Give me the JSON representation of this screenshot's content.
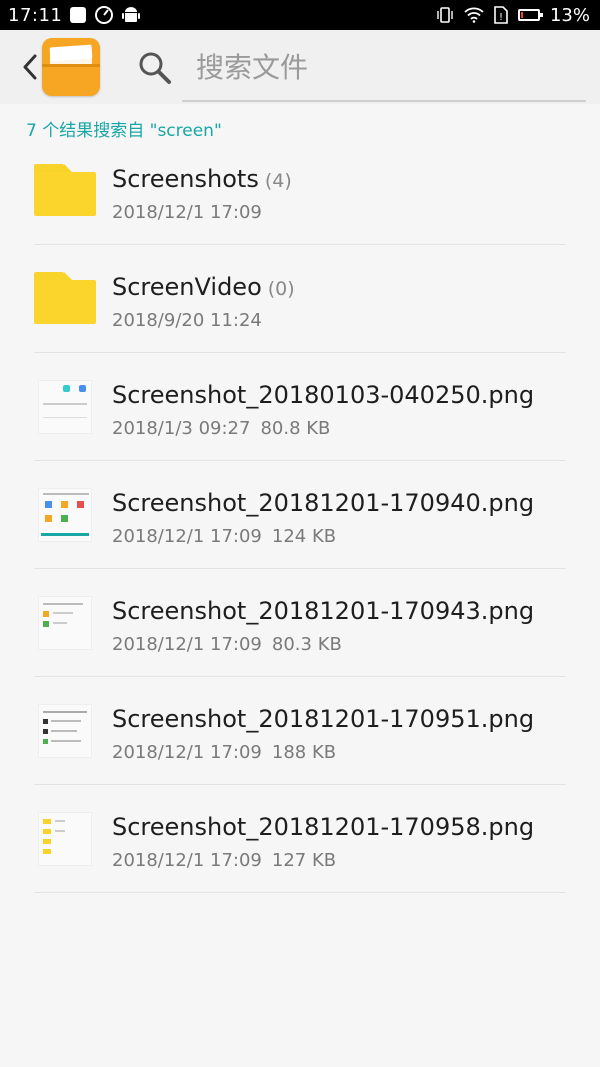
{
  "status_bar": {
    "time": "17:11",
    "battery": "13%",
    "battery_level": 0.13
  },
  "header": {
    "back_icon": "chevron-left-icon",
    "app_icon": "file-manager-icon",
    "search_icon": "search-icon",
    "search_placeholder": "搜索文件"
  },
  "summary": "7 个结果搜索自 \"screen\"",
  "items": [
    {
      "type": "folder",
      "name": "Screenshots",
      "count": "(4)",
      "date": "2018/12/1 17:09",
      "size": ""
    },
    {
      "type": "folder",
      "name": "ScreenVideo",
      "count": "(0)",
      "date": "2018/9/20 11:24",
      "size": ""
    },
    {
      "type": "image",
      "name": "Screenshot_20180103-040250.png",
      "count": "",
      "date": "2018/1/3 09:27",
      "size": "80.8 KB"
    },
    {
      "type": "image",
      "name": "Screenshot_20181201-170940.png",
      "count": "",
      "date": "2018/12/1 17:09",
      "size": "124 KB"
    },
    {
      "type": "image",
      "name": "Screenshot_20181201-170943.png",
      "count": "",
      "date": "2018/12/1 17:09",
      "size": "80.3 KB"
    },
    {
      "type": "image",
      "name": "Screenshot_20181201-170951.png",
      "count": "",
      "date": "2018/12/1 17:09",
      "size": "188 KB"
    },
    {
      "type": "image",
      "name": "Screenshot_20181201-170958.png",
      "count": "",
      "date": "2018/12/1 17:09",
      "size": "127 KB"
    }
  ],
  "colors": {
    "accent": "#19a6a6",
    "folder": "#fbd52b",
    "app_icon": "#f6a623",
    "battery_low": "#ff3b30"
  }
}
